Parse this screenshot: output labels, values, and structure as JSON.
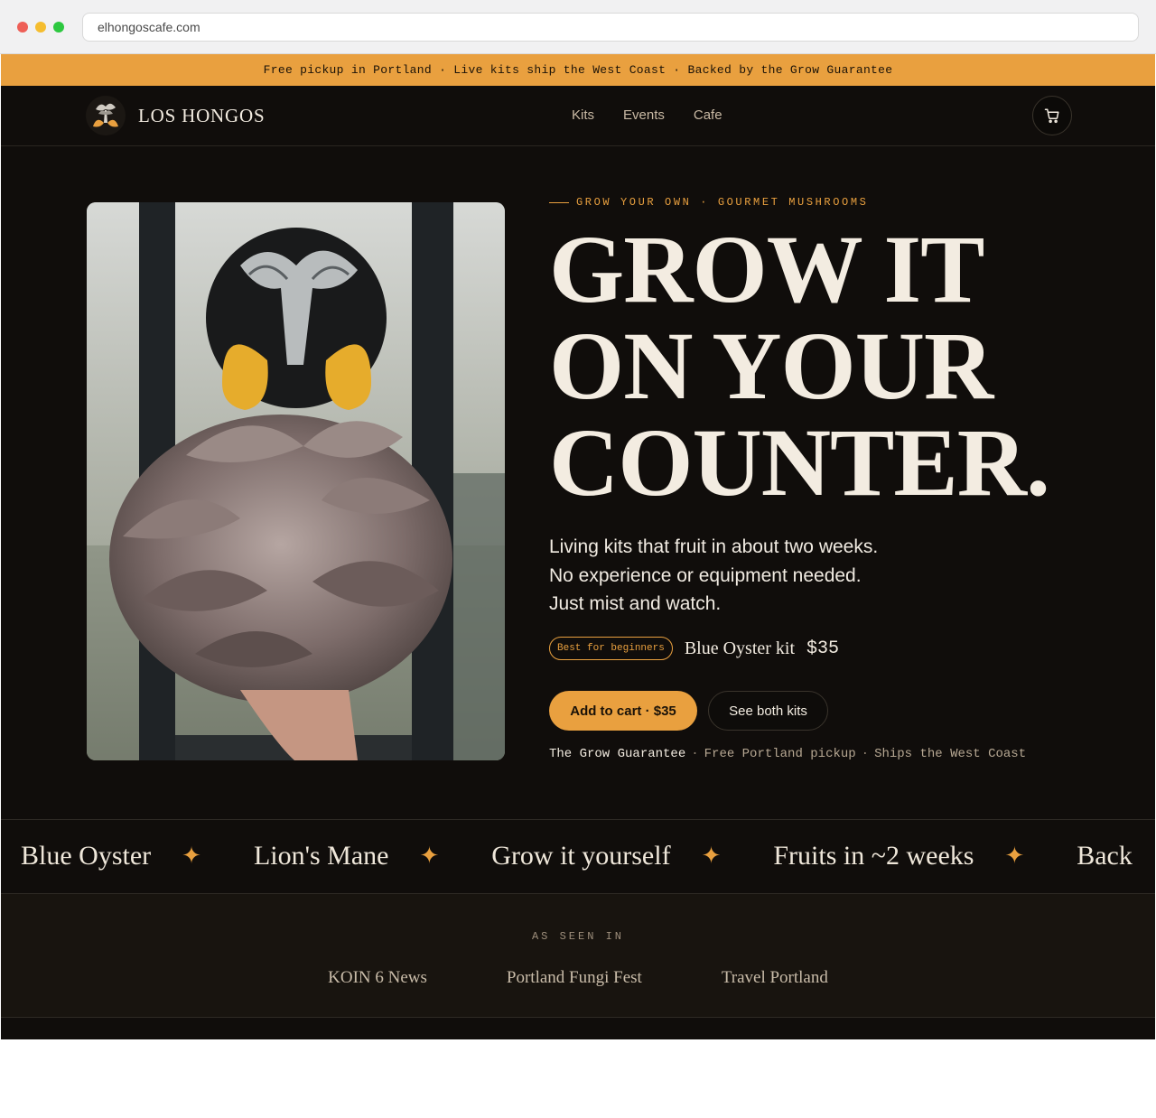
{
  "browser": {
    "url": "elhongoscafe.com"
  },
  "announcement": {
    "text": "Free pickup in Portland · Live kits ship the West Coast · Backed by the Grow Guarantee"
  },
  "nav": {
    "brand": "LOS HONGOS",
    "links": [
      "Kits",
      "Events",
      "Cafe"
    ],
    "cart_icon": "cart-icon"
  },
  "hero": {
    "eyebrow": "GROW YOUR OWN · GOURMET MUSHROOMS",
    "headline": [
      "GROW IT",
      "ON YOUR",
      "COUNTER"
    ],
    "headline_period": ".",
    "subtext": "Living kits that fruit in about two weeks. No experience or equipment needed. Just mist and watch.",
    "badge": "Best for beginners",
    "kit_name": "Blue Oyster kit",
    "kit_price": "$35",
    "cta_primary": "Add to cart · $35",
    "cta_secondary": "See both kits",
    "assurances": [
      "The Grow Guarantee",
      "Free Portland pickup",
      "Ships the West Coast"
    ]
  },
  "marquee": {
    "items": [
      "Blue Oyster",
      "Lion's Mane",
      "Grow it yourself",
      "Fruits in ~2 weeks",
      "Back"
    ],
    "separator_icon": "star-icon",
    "separator": "✦"
  },
  "press": {
    "label": "AS SEEN IN",
    "outlets": [
      "KOIN 6 News",
      "Portland Fungi Fest",
      "Travel Portland"
    ]
  },
  "colors": {
    "accent": "#e9a03f",
    "background": "#100d0b",
    "text": "#f3ece1"
  }
}
